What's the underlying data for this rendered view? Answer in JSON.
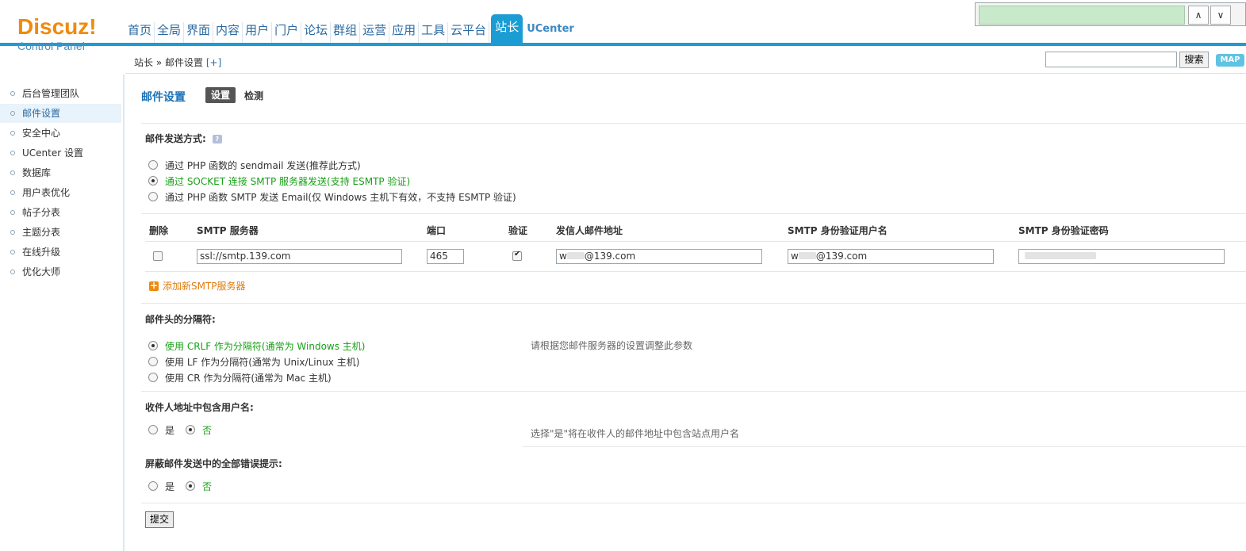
{
  "logo": {
    "main": "Discuz!",
    "sub": "Control Panel"
  },
  "nav": {
    "items": [
      "首页",
      "全局",
      "界面",
      "内容",
      "用户",
      "门户",
      "论坛",
      "群组",
      "运营",
      "应用",
      "工具",
      "云平台",
      "站长",
      "UCenter"
    ],
    "active": "站长"
  },
  "breadcrumb": {
    "section": "站长",
    "sep": "»",
    "page": "邮件设置",
    "plus": "[+]"
  },
  "search": {
    "button": "搜索",
    "map": "MAP"
  },
  "overlay": {
    "up": "∧",
    "down": "∨"
  },
  "sidebar": {
    "items": [
      "后台管理团队",
      "邮件设置",
      "安全中心",
      "UCenter 设置",
      "数据库",
      "用户表优化",
      "帖子分表",
      "主题分表",
      "在线升级",
      "优化大师"
    ],
    "active_index": 1
  },
  "main": {
    "title": "邮件设置",
    "tabs": {
      "settings": "设置",
      "detect": "检测"
    },
    "send_method": {
      "title": "邮件发送方式:",
      "help": "?",
      "options": [
        "通过 PHP 函数的 sendmail 发送(推荐此方式)",
        "通过 SOCKET 连接 SMTP 服务器发送(支持 ESMTP 验证)",
        "通过 PHP 函数 SMTP 发送 Email(仅 Windows 主机下有效，不支持 ESMTP 验证)"
      ],
      "selected_index": 1
    },
    "smtp_table": {
      "headers": {
        "delete": "删除",
        "server": "SMTP 服务器",
        "port": "端口",
        "auth": "验证",
        "from": "发信人邮件地址",
        "user": "SMTP 身份验证用户名",
        "password": "SMTP 身份验证密码"
      },
      "row": {
        "server": "ssl://smtp.139.com",
        "port": "465",
        "auth_checked": true,
        "from_prefix": "w",
        "from_suffix": "@139.com",
        "user_prefix": "w",
        "user_suffix": "@139.com"
      },
      "add_label": "添加新SMTP服务器",
      "add_icon": "+"
    },
    "header_separator": {
      "title": "邮件头的分隔符:",
      "options": [
        "使用 CRLF 作为分隔符(通常为 Windows 主机)",
        "使用 LF 作为分隔符(通常为 Unix/Linux 主机)",
        "使用 CR 作为分隔符(通常为 Mac 主机)"
      ],
      "selected_index": 0,
      "tip": "请根据您邮件服务器的设置调整此参数"
    },
    "include_username": {
      "title": "收件人地址中包含用户名:",
      "yes": "是",
      "no": "否",
      "selected": "否",
      "tip": "选择\"是\"将在收件人的邮件地址中包含站点用户名"
    },
    "silence_errors": {
      "title": "屏蔽邮件发送中的全部错误提示:",
      "yes": "是",
      "no": "否",
      "selected": "否"
    },
    "submit": "提交"
  },
  "colors": {
    "accent": "#1b9dd4",
    "logo": "#f08a0e",
    "selected_text": "#17a016",
    "link": "#2a6aa2"
  }
}
